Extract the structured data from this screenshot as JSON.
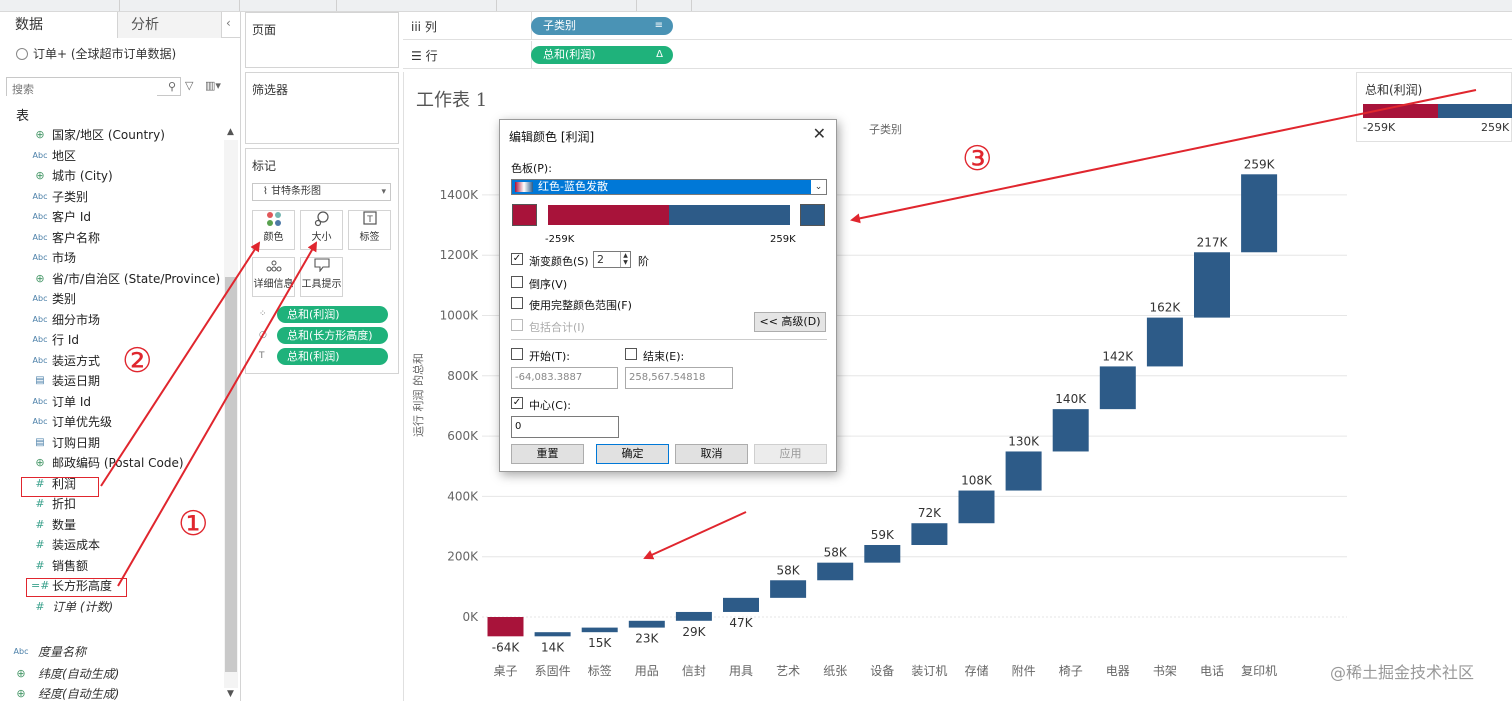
{
  "data_pane": {
    "tab_data": "数据",
    "tab_analysis": "分析",
    "collapse_glyph": "‹",
    "datasource": "订单+ (全球超市订单数据)",
    "search_placeholder": "搜索",
    "tables_header": "表",
    "fields": [
      {
        "type": "geo",
        "type_label": "⊕",
        "name": "国家/地区 (Country)",
        "italic": false
      },
      {
        "type": "dim",
        "type_label": "Abc",
        "name": "地区",
        "italic": false
      },
      {
        "type": "geo",
        "type_label": "⊕",
        "name": "城市 (City)",
        "italic": false
      },
      {
        "type": "dim",
        "type_label": "Abc",
        "name": "子类别",
        "italic": false
      },
      {
        "type": "dim",
        "type_label": "Abc",
        "name": "客户 Id",
        "italic": false
      },
      {
        "type": "dim",
        "type_label": "Abc",
        "name": "客户名称",
        "italic": false
      },
      {
        "type": "dim",
        "type_label": "Abc",
        "name": "市场",
        "italic": false
      },
      {
        "type": "geo",
        "type_label": "⊕",
        "name": "省/市/自治区 (State/Province)",
        "italic": false
      },
      {
        "type": "dim",
        "type_label": "Abc",
        "name": "类别",
        "italic": false
      },
      {
        "type": "dim",
        "type_label": "Abc",
        "name": "细分市场",
        "italic": false
      },
      {
        "type": "dim",
        "type_label": "Abc",
        "name": "行 Id",
        "italic": false
      },
      {
        "type": "dim",
        "type_label": "Abc",
        "name": "装运方式",
        "italic": false
      },
      {
        "type": "date",
        "type_label": "▤",
        "name": "装运日期",
        "italic": false
      },
      {
        "type": "dim",
        "type_label": "Abc",
        "name": "订单 Id",
        "italic": false
      },
      {
        "type": "dim",
        "type_label": "Abc",
        "name": "订单优先级",
        "italic": false
      },
      {
        "type": "date",
        "type_label": "▤",
        "name": "订购日期",
        "italic": false
      },
      {
        "type": "geo",
        "type_label": "⊕",
        "name": "邮政编码 (Postal Code)",
        "italic": false
      },
      {
        "type": "meas",
        "type_label": "#",
        "name": "利润",
        "italic": false
      },
      {
        "type": "meas",
        "type_label": "#",
        "name": "折扣",
        "italic": false
      },
      {
        "type": "meas",
        "type_label": "#",
        "name": "数量",
        "italic": false
      },
      {
        "type": "meas",
        "type_label": "#",
        "name": "装运成本",
        "italic": false
      },
      {
        "type": "meas",
        "type_label": "#",
        "name": "销售额",
        "italic": false
      },
      {
        "type": "meas",
        "type_label": "=#",
        "name": "长方形高度",
        "italic": false
      },
      {
        "type": "meas",
        "type_label": "#",
        "name": "订单 (计数)",
        "italic": true
      }
    ],
    "extra_fields": [
      {
        "type": "dim",
        "type_label": "Abc",
        "name": "度量名称"
      },
      {
        "type": "geo",
        "type_label": "⊕",
        "name": "纬度(自动生成)"
      },
      {
        "type": "geo",
        "type_label": "⊕",
        "name": "经度(自动生成)"
      }
    ]
  },
  "pages_card": {
    "title": "页面"
  },
  "filters_card": {
    "title": "筛选器"
  },
  "marks_card": {
    "title": "标记",
    "mark_type": "甘特条形图",
    "buttons": [
      {
        "id": "color",
        "label": "颜色",
        "icon": "color-dots-icon"
      },
      {
        "id": "size",
        "label": "大小",
        "icon": "size-icon"
      },
      {
        "id": "label",
        "label": "标签",
        "icon": "text-label-icon"
      },
      {
        "id": "detail",
        "label": "详细信息",
        "icon": "detail-dots-icon"
      },
      {
        "id": "tooltip",
        "label": "工具提示",
        "icon": "tooltip-icon"
      }
    ],
    "pills": [
      {
        "label": "总和(利润)",
        "icon": "color-dots-icon"
      },
      {
        "label": "总和(长方形高度)",
        "icon": "size-icon"
      },
      {
        "label": "总和(利润)",
        "icon": "text-label-icon"
      }
    ]
  },
  "columns_shelf": {
    "label": "列",
    "pill": "子类别",
    "pill_color": "#4a93b5",
    "pill_glyph": "≡"
  },
  "rows_shelf": {
    "label": "行",
    "pill": "总和(利润)",
    "pill_color": "#1fb27b",
    "pill_glyph": "Δ"
  },
  "worksheet": {
    "title": "工作表 1"
  },
  "legend": {
    "title": "总和(利润)",
    "min_label": "-259K",
    "max_label": "259K",
    "low_color": "#a8133a",
    "high_color": "#2d5b88"
  },
  "chart_data": {
    "type": "bar",
    "subtype": "waterfall-gantt",
    "title": "",
    "xlabel": "子类别",
    "ylabel": "运行 利润 的总和",
    "ylim": [
      -50000,
      1550000
    ],
    "yticks": [
      0,
      200000,
      400000,
      600000,
      800000,
      1000000,
      1200000,
      1400000
    ],
    "ytick_labels": [
      "0K",
      "200K",
      "400K",
      "600K",
      "800K",
      "1000K",
      "1200K",
      "1400K"
    ],
    "grid": true,
    "categories": [
      "桌子",
      "系固件",
      "标签",
      "用品",
      "信封",
      "用具",
      "艺术",
      "纸张",
      "设备",
      "装订机",
      "存储",
      "附件",
      "椅子",
      "电器",
      "书架",
      "电话",
      "复印机"
    ],
    "values": [
      -64083,
      13700,
      15200,
      22600,
      29300,
      46800,
      58300,
      58400,
      58600,
      72200,
      108400,
      129600,
      140400,
      141700,
      161900,
      216700,
      258600
    ],
    "value_labels": [
      "-64K",
      "14K",
      "15K",
      "23K",
      "29K",
      "47K",
      "58K",
      "58K",
      "59K",
      "72K",
      "108K",
      "130K",
      "140K",
      "142K",
      "162K",
      "217K",
      "259K"
    ],
    "colors": {
      "negative": "#a8133a",
      "positive": "#2d5b88"
    }
  },
  "dialog": {
    "title": "编辑颜色 [利润]",
    "close_glyph": "✕",
    "palette_label": "色板(P):",
    "palette_value": "红色-蓝色发散",
    "grad_min_label": "-259K",
    "grad_max_label": "259K",
    "stepped_label": "渐变颜色(S)",
    "stepped_checked": "✓",
    "stepped_value": "2",
    "stepped_unit": "阶",
    "reversed_label": "倒序(V)",
    "full_range_label": "使用完整颜色范围(F)",
    "include_totals_label": "包括合计(I)",
    "advanced_button": "<< 高级(D)",
    "start_label": "开始(T):",
    "end_label": "结束(E):",
    "start_value": "-64,083.3887",
    "end_value": "258,567.54818",
    "center_label": "中心(C):",
    "center_checked": "✓",
    "center_value": "0",
    "reset_button": "重置",
    "ok_button": "确定",
    "cancel_button": "取消",
    "apply_button": "应用"
  },
  "annotations": {
    "labels": [
      "①",
      "②",
      "③"
    ],
    "color": "#e0262e"
  },
  "watermark": "@稀土掘金技术社区"
}
